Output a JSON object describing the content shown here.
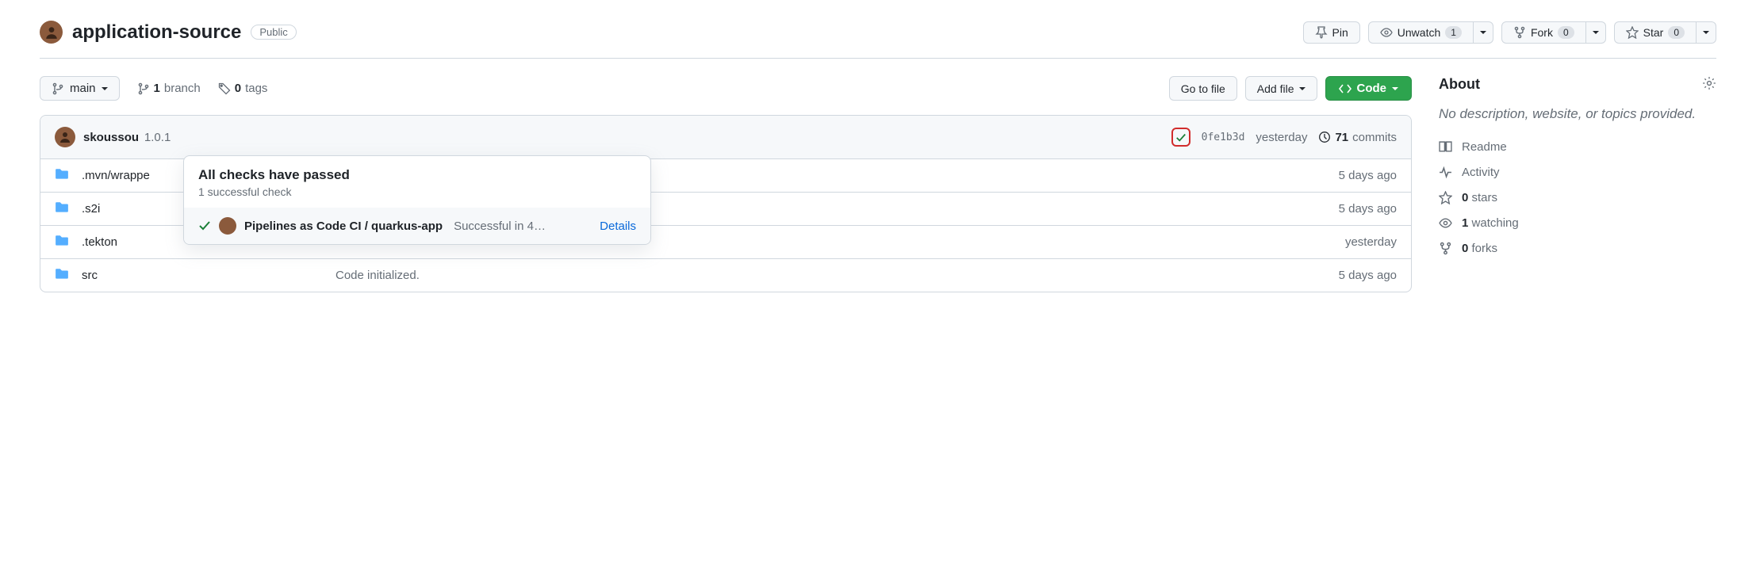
{
  "header": {
    "repo_name": "application-source",
    "visibility": "Public",
    "pin_label": "Pin",
    "unwatch_label": "Unwatch",
    "unwatch_count": "1",
    "fork_label": "Fork",
    "fork_count": "0",
    "star_label": "Star",
    "star_count": "0"
  },
  "filenav": {
    "branch": "main",
    "branch_count": "1",
    "branch_word": "branch",
    "tag_count": "0",
    "tag_word": "tags",
    "go_to_file": "Go to file",
    "add_file": "Add file",
    "code": "Code"
  },
  "commitbar": {
    "author": "skoussou",
    "message": "1.0.1",
    "sha": "0fe1b3d",
    "time": "yesterday",
    "commit_count": "71",
    "commit_word": "commits"
  },
  "files": [
    {
      "name": ".mvn/wrappe",
      "msg": "",
      "age": "5 days ago"
    },
    {
      "name": ".s2i",
      "msg": "",
      "age": "5 days ago"
    },
    {
      "name": ".tekton",
      "msg": "",
      "age": "yesterday"
    },
    {
      "name": "src",
      "msg": "Code initialized.",
      "age": "5 days ago"
    }
  ],
  "popover": {
    "title": "All checks have passed",
    "subtitle": "1 successful check",
    "ci_name": "Pipelines as Code CI / quarkus-app",
    "ci_status": "Successful in 4…",
    "details": "Details"
  },
  "about": {
    "title": "About",
    "description": "No description, website, or topics provided.",
    "readme": "Readme",
    "activity": "Activity",
    "stars_count": "0",
    "stars_word": "stars",
    "watching_count": "1",
    "watching_word": "watching",
    "forks_count": "0",
    "forks_word": "forks"
  }
}
